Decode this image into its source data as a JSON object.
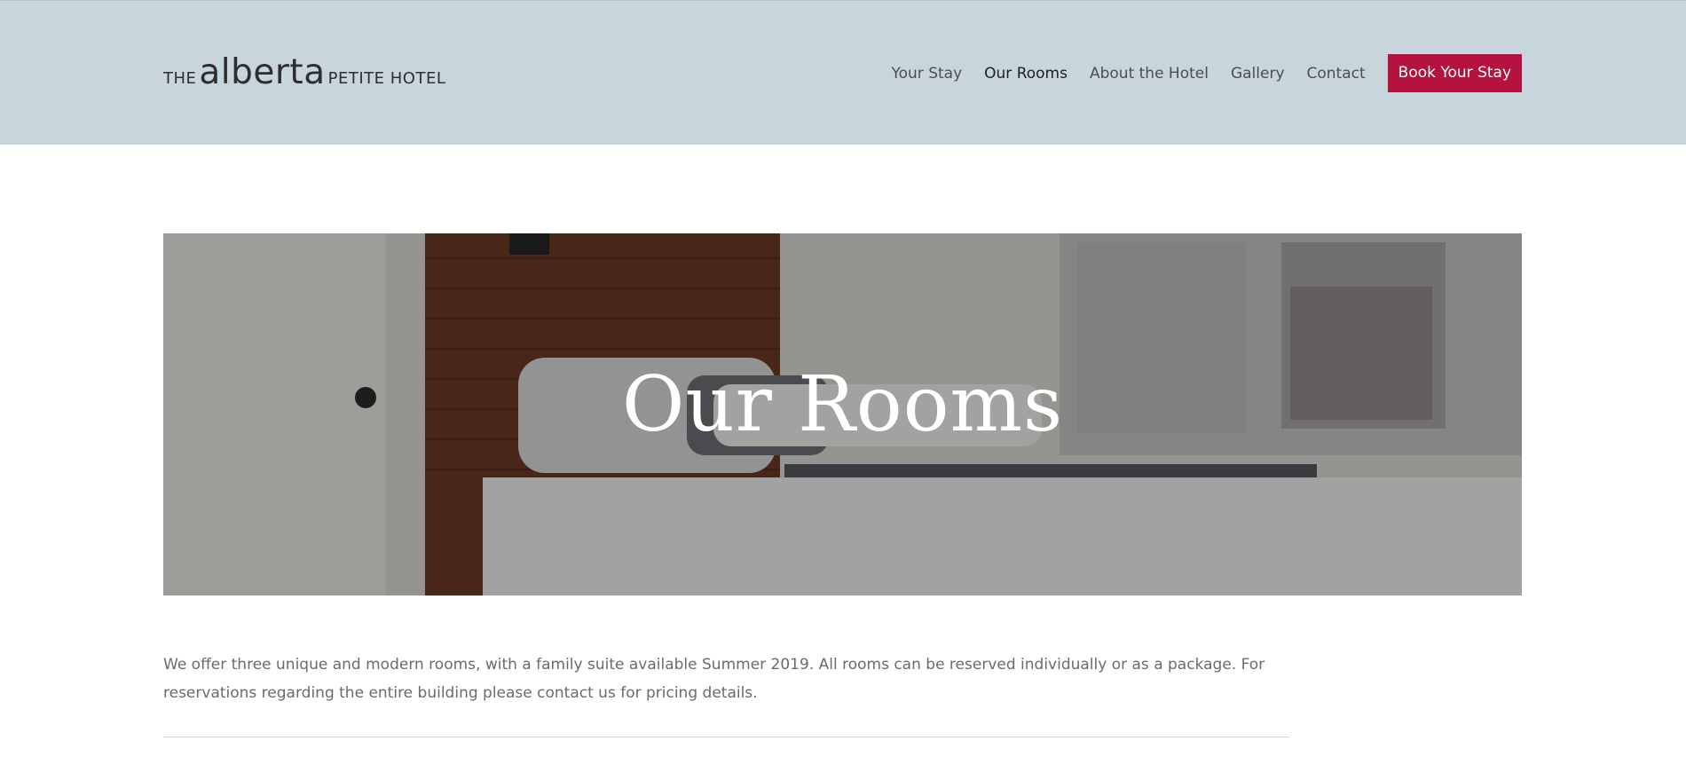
{
  "logo": {
    "prefix": "THE",
    "name": "alberta",
    "suffix": "PETITE HOTEL"
  },
  "nav": {
    "items": [
      {
        "label": "Your Stay",
        "active": false
      },
      {
        "label": "Our Rooms",
        "active": true
      },
      {
        "label": "About the Hotel",
        "active": false
      },
      {
        "label": "Gallery",
        "active": false
      },
      {
        "label": "Contact",
        "active": false
      }
    ],
    "cta": "Book Your Stay"
  },
  "hero": {
    "title": "Our Rooms",
    "image_subject": "hotel-bedroom-photo"
  },
  "main": {
    "intro": "We offer three unique and modern rooms, with a family suite available Summer 2019. All rooms can be reserved individually or as a package. For reservations regarding the entire building please contact us for pricing details."
  },
  "colors": {
    "header_bg": "#c9d5dd",
    "accent": "#b5123e",
    "text": "#6b6b6b"
  }
}
